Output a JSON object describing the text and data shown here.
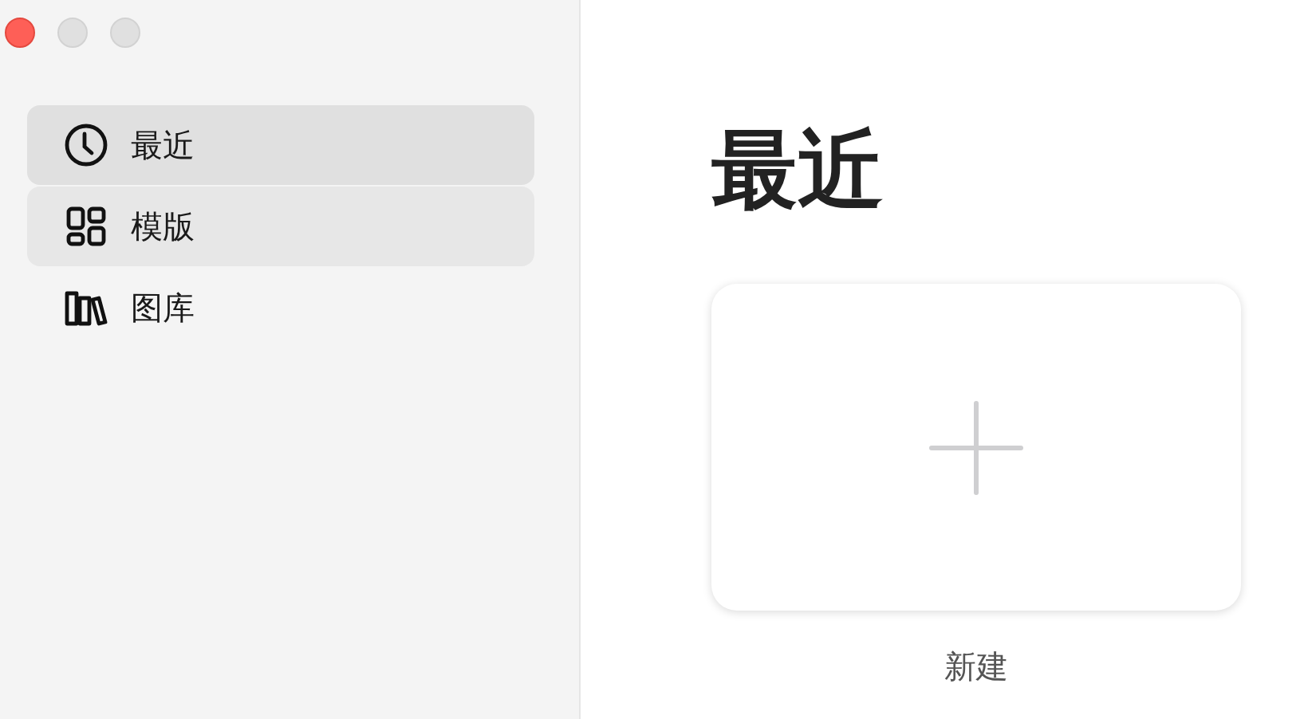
{
  "window": {
    "controls": [
      {
        "kind": "close",
        "active": true
      },
      {
        "kind": "minimize",
        "active": false
      },
      {
        "kind": "zoom",
        "active": false
      }
    ]
  },
  "sidebar": {
    "items": [
      {
        "kind": "clock",
        "label": "最近",
        "selected": true,
        "hovered": false
      },
      {
        "kind": "grid",
        "label": "模版",
        "selected": false,
        "hovered": true
      },
      {
        "kind": "books",
        "label": "图库",
        "selected": false,
        "hovered": false
      }
    ]
  },
  "content": {
    "title": "最近",
    "new_card": {
      "label": "新建"
    }
  }
}
